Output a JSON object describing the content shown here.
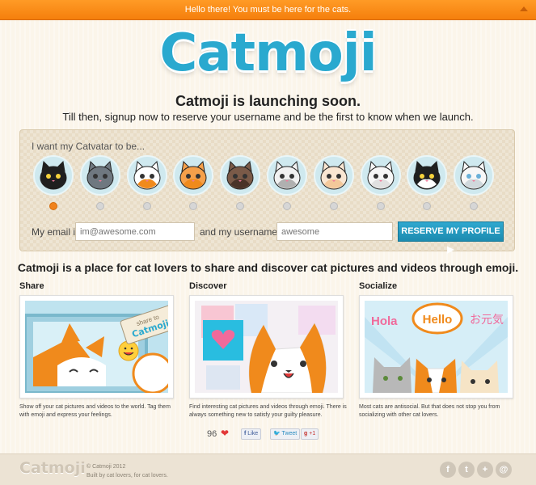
{
  "topbar": {
    "message": "Hello there! You must be here for the cats."
  },
  "logo": {
    "text": "Catmoji"
  },
  "hero": {
    "headline": "Catmoji is launching soon.",
    "subline": "Till then, signup now to reserve your username and be the first to know when we launch."
  },
  "signup": {
    "catvatar_label": "I want my Catvatar to be...",
    "catvatars": [
      {
        "name": "black",
        "selected": true
      },
      {
        "name": "gray",
        "selected": false
      },
      {
        "name": "calico",
        "selected": false
      },
      {
        "name": "orange",
        "selected": false
      },
      {
        "name": "brown-tabby",
        "selected": false
      },
      {
        "name": "white-gray",
        "selected": false
      },
      {
        "name": "cream",
        "selected": false
      },
      {
        "name": "white",
        "selected": false
      },
      {
        "name": "tuxedo",
        "selected": false
      },
      {
        "name": "white-blue-eyes",
        "selected": false
      }
    ],
    "email_label": "My email is",
    "email_placeholder": "im@awesome.com",
    "username_label": "and my username is",
    "username_placeholder": "awesome",
    "reserve_button": "RESERVE MY PROFILE ▶"
  },
  "tagline": "Catmoji is a place for cat lovers to share and discover cat pictures and videos through emoji.",
  "features": [
    {
      "title": "Share",
      "desc": "Show off your cat pictures and videos to the world. Tag them with emoji and express your feelings.",
      "sign_text": "share to Catmoji"
    },
    {
      "title": "Discover",
      "desc": "Find interesting cat pictures and videos through emoji. There is always something new to satisfy your guilty pleasure."
    },
    {
      "title": "Socialize",
      "desc": "Most cats are antisocial. But that does not stop you from socializing with other cat lovers.",
      "bubbles": [
        "Hola",
        "Hello",
        "お元気"
      ]
    }
  ],
  "social": {
    "count": "96",
    "like": "Like",
    "tweet": "Tweet",
    "plusone": "+1"
  },
  "footer": {
    "logo": "Catmoji",
    "copyright": "© Catmoji 2012",
    "byline": "Built by cat lovers, for cat lovers.",
    "icons": [
      "facebook-icon",
      "twitter-icon",
      "plus-icon",
      "email-icon"
    ]
  },
  "colors": {
    "orange": "#f58a1c",
    "blue": "#2aa9cf",
    "background": "#fbf5ea"
  }
}
